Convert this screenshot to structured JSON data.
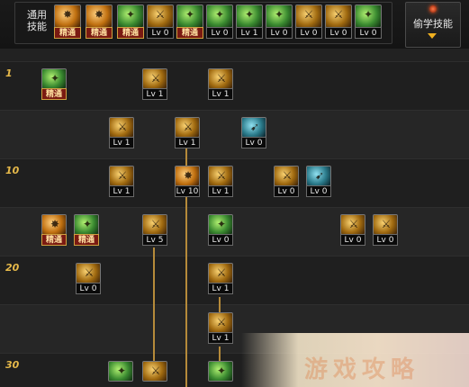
{
  "top_bar": {
    "general_label": "通用\n技能",
    "general_skills": [
      {
        "icon": "sitting-figure-icon",
        "level": "精通",
        "mastered": true,
        "style": "orange"
      },
      {
        "icon": "wind-spin-icon",
        "level": "精通",
        "mastered": true,
        "style": "orange"
      },
      {
        "icon": "running-figure-icon",
        "level": "精通",
        "mastered": true,
        "style": "green"
      },
      {
        "icon": "wings-icon",
        "level": "Lv 0",
        "mastered": false,
        "style": "gold"
      },
      {
        "icon": "compass-icon",
        "level": "精通",
        "mastered": true,
        "style": "green"
      },
      {
        "icon": "green-burst-icon",
        "level": "Lv 0",
        "mastered": false,
        "style": "green"
      },
      {
        "icon": "green-figure-icon",
        "level": "Lv 1",
        "mastered": false,
        "style": "green"
      },
      {
        "icon": "green-bottle-icon",
        "level": "Lv 0",
        "mastered": false,
        "style": "green"
      },
      {
        "icon": "shield-ring-icon",
        "level": "Lv 0",
        "mastered": false,
        "style": "gold"
      },
      {
        "icon": "gold-figure-icon",
        "level": "Lv 0",
        "mastered": false,
        "style": "gold"
      },
      {
        "icon": "green-dancer-icon",
        "level": "Lv 0",
        "mastered": false,
        "style": "green"
      }
    ],
    "steal_label": "偷学技能"
  },
  "rows": [
    {
      "label": "1"
    },
    {
      "label": ""
    },
    {
      "label": "10"
    },
    {
      "label": ""
    },
    {
      "label": "20"
    },
    {
      "label": ""
    },
    {
      "label": "30"
    }
  ],
  "tree_skills": [
    {
      "icon": "green-leap-icon",
      "level": "精通",
      "mastered": true,
      "style": "green"
    },
    {
      "icon": "gold-swing-icon",
      "level": "Lv 1",
      "mastered": false,
      "style": "gold"
    },
    {
      "icon": "gold-cross-icon",
      "level": "Lv 1",
      "mastered": false,
      "style": "gold"
    },
    {
      "icon": "gold-burst-icon",
      "level": "Lv 1",
      "mastered": false,
      "style": "gold"
    },
    {
      "icon": "gold-slash-icon",
      "level": "Lv 1",
      "mastered": false,
      "style": "gold"
    },
    {
      "icon": "teal-dash-icon",
      "level": "Lv 0",
      "mastered": false,
      "style": "teal"
    },
    {
      "icon": "gold-claw-icon",
      "level": "Lv 1",
      "mastered": false,
      "style": "gold"
    },
    {
      "icon": "orange-flame-icon",
      "level": "Lv 10",
      "mastered": false,
      "style": "orange"
    },
    {
      "icon": "gold-blade-icon",
      "level": "Lv 1",
      "mastered": false,
      "style": "gold"
    },
    {
      "icon": "gold-kick-icon",
      "level": "Lv 0",
      "mastered": false,
      "style": "gold"
    },
    {
      "icon": "teal-fist-icon",
      "level": "Lv 0",
      "mastered": false,
      "style": "teal"
    },
    {
      "icon": "gold-rifle-icon",
      "level": "精通",
      "mastered": true,
      "style": "orange"
    },
    {
      "icon": "green-sword-icon",
      "level": "精通",
      "mastered": true,
      "style": "green"
    },
    {
      "icon": "gold-cloud-icon",
      "level": "Lv 5",
      "mastered": false,
      "style": "gold"
    },
    {
      "icon": "green-beast-icon",
      "level": "Lv 0",
      "mastered": false,
      "style": "green"
    },
    {
      "icon": "gold-hammer-icon",
      "level": "Lv 0",
      "mastered": false,
      "style": "gold"
    },
    {
      "icon": "gold-bag-icon",
      "level": "Lv 0",
      "mastered": false,
      "style": "gold"
    },
    {
      "icon": "gold-shot-icon",
      "level": "Lv 0",
      "mastered": false,
      "style": "gold"
    },
    {
      "icon": "gold-eye-icon",
      "level": "Lv 1",
      "mastered": false,
      "style": "gold"
    },
    {
      "icon": "gold-arrow-icon",
      "level": "Lv 1",
      "mastered": false,
      "style": "gold"
    },
    {
      "icon": "green-lance-icon",
      "level": "",
      "mastered": false,
      "style": "green"
    },
    {
      "icon": "gold-gun-icon",
      "level": "",
      "mastered": false,
      "style": "gold"
    },
    {
      "icon": "green-star-icon",
      "level": "",
      "mastered": false,
      "style": "green"
    }
  ],
  "colors": {
    "gold": "#e6b94a",
    "mastered_bg": "#7a1a12",
    "line": "#b58a3a"
  }
}
